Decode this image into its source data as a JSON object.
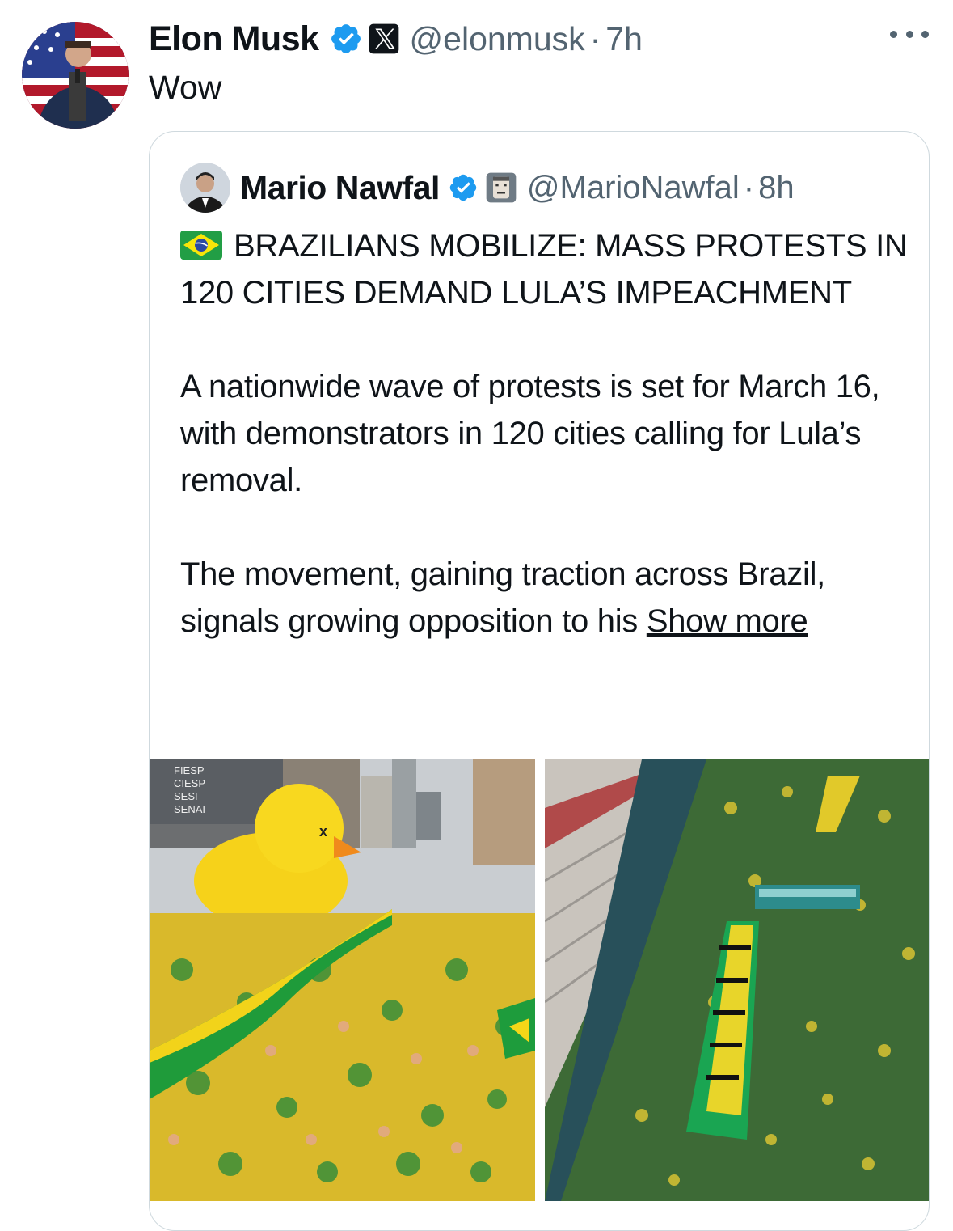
{
  "post": {
    "author_name": "Elon Musk",
    "author_handle": "@elonmusk",
    "separator": "·",
    "time": "7h",
    "text": "Wow",
    "verified_color": "#1d9bf0"
  },
  "quoted": {
    "author_name": "Mario Nawfal",
    "author_handle": "@MarioNawfal",
    "separator": "·",
    "time": "8h",
    "headline": "BRAZILIANS MOBILIZE: MASS PROTESTS IN 120 CITIES DEMAND LULA’S IMPEACHMENT",
    "paragraph_1": "A nationwide wave of protests is set for March 16, with demonstrators in 120 cities calling for Lula’s removal.",
    "paragraph_2_prefix": "The movement, gaining traction across Brazil, signals growing opposition to his",
    "show_more": "Show more",
    "flag_icon": "brazil-flag-icon"
  },
  "media": {
    "image_1_sign": "FIESP\nCIESP\nSESI\nSENAI",
    "image_1_alt_icon": "protest-photo-duck",
    "image_2_alt_icon": "protest-photo-aerial"
  }
}
